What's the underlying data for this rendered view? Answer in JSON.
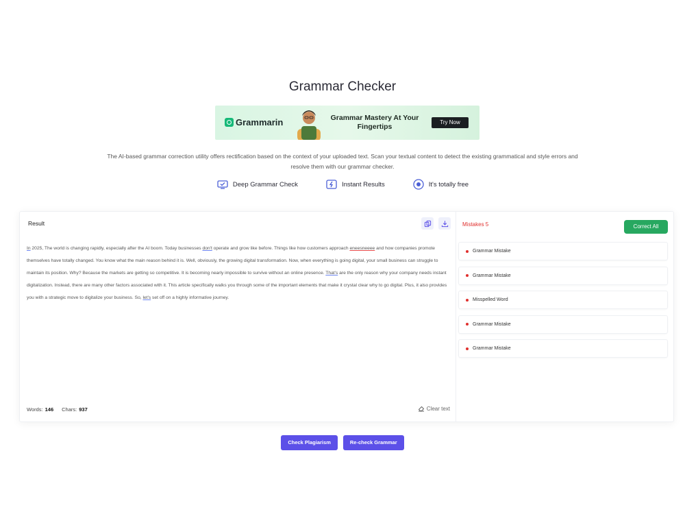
{
  "page": {
    "title": "Grammar Checker",
    "intro": "The AI-based grammar correction utility offers rectification based on the context of your uploaded text. Scan your textual content to detect the existing grammatical and style errors and resolve them with our grammar checker."
  },
  "banner": {
    "brand": "Grammarin",
    "headline": "Grammar Mastery At Your Fingertips",
    "cta": "Try Now",
    "brand_color": "#16b978"
  },
  "features": [
    {
      "label": "Deep Grammar Check",
      "icon": "monitor-check-icon"
    },
    {
      "label": "Instant Results",
      "icon": "lightning-icon"
    },
    {
      "label": "It's totally free",
      "icon": "circle-dot-icon"
    }
  ],
  "result": {
    "title": "Result",
    "segments": [
      {
        "t": "In",
        "e": "err-blue"
      },
      {
        "t": " 2025, The world is changing rapidly, especially after the AI boom. Today businesses "
      },
      {
        "t": "don't",
        "e": "err-blue"
      },
      {
        "t": " operate and grow like before. Things like how customers approach "
      },
      {
        "t": "eneesneeee",
        "e": "err"
      },
      {
        "t": " and how companies promote themselves have totally changed. You know what the main reason behind it is. Well, obviously, the growing digital transformation. Now, when everything is going digital, your small business can struggle to maintain its position. Why? Because the markets are getting so competitive. It is becoming nearly impossible to survive without an online presence. "
      },
      {
        "t": "That's",
        "e": "err-blue"
      },
      {
        "t": " are the only reason why your company needs instant digitalization. Instead, there are many other factors associated with it. This article specifically walks you through some of the important elements that make it crystal clear why to go digital. Plus, it also provides you with a strategic move to digitalize your business. So, "
      },
      {
        "t": "let's",
        "e": "err-blue"
      },
      {
        "t": " set off on a highly informative journey."
      }
    ],
    "words_label": "Words:",
    "words": "146",
    "chars_label": "Chars:",
    "chars": "937",
    "clear_label": "Clear text"
  },
  "mistakes": {
    "label": "Mistakes 5",
    "correct_all": "Correct All",
    "items": [
      "Grammar Mistake",
      "Grammar Mistake",
      "Misspelled Word",
      "Grammar Mistake",
      "Grammar Mistake"
    ]
  },
  "actions": {
    "plagiarism": "Check Plagiarism",
    "recheck": "Re-check Grammar"
  },
  "colors": {
    "accent": "#5c50e8",
    "success": "#27a860",
    "error": "#e0302e"
  }
}
